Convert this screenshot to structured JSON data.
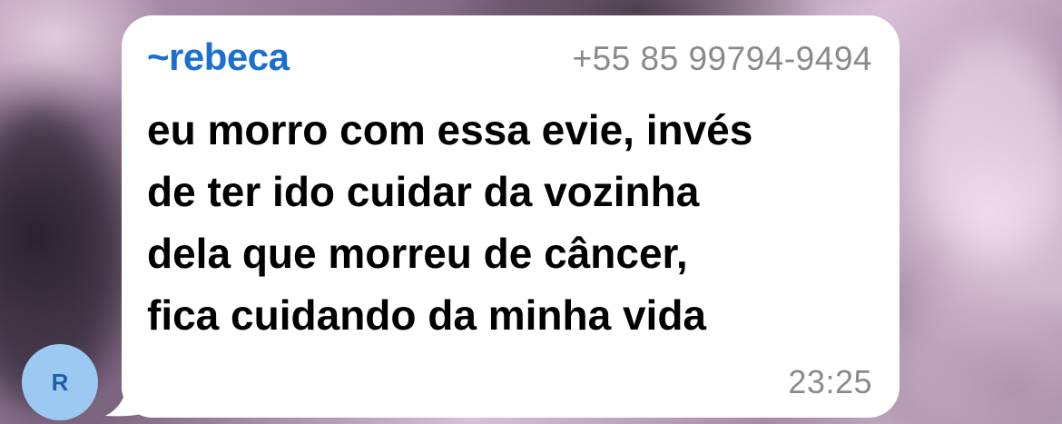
{
  "message": {
    "sender_name": "~rebeca",
    "sender_phone": "+55 85 99794-9494",
    "lines": [
      "eu morro com essa evie, invés",
      "de ter ido cuidar da vozinha",
      "dela que morreu de câncer,",
      "fica cuidando da minha vida"
    ],
    "time": "23:25"
  },
  "avatar": {
    "initial": "R",
    "color": "#9cc9f2"
  },
  "colors": {
    "bubble": "#ffffff",
    "sender_name": "#1b6fd0",
    "meta_text": "#8a8a8e"
  }
}
